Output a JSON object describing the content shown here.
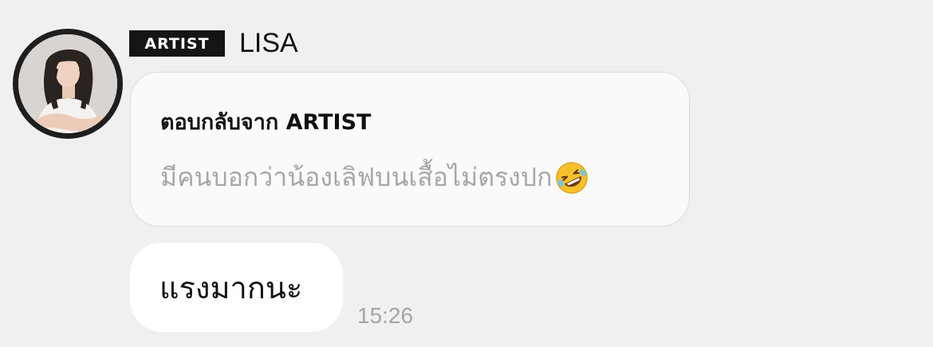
{
  "sender": {
    "badge": "ARTIST",
    "name": "LISA",
    "avatar": "profile-photo"
  },
  "reply": {
    "header": "ตอบกลับจาก ARTIST",
    "quoted_text": "มีคนบอกว่าน้องเลิฟบนเสื้อไม่ตรงปก",
    "emoji": "rolling-on-floor-laughing-emoji"
  },
  "message": {
    "text": "แรงมากนะ",
    "time": "15:26"
  },
  "colors": {
    "background": "#f0f0f0",
    "badge_bg": "#151515",
    "bubble_bg": "#ffffff",
    "reply_bubble_bg": "#fafafa",
    "muted_text": "#a7a7a7"
  }
}
